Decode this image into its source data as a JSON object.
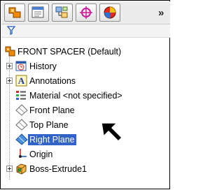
{
  "toolbar": {
    "tabs": [
      {
        "icon": "feature-manager-icon"
      },
      {
        "icon": "property-manager-icon"
      },
      {
        "icon": "configuration-manager-icon"
      },
      {
        "icon": "dimxpert-manager-icon"
      },
      {
        "icon": "display-manager-icon"
      }
    ],
    "overflow_label": "»"
  },
  "filter": {
    "icon": "filter-icon"
  },
  "tree": {
    "root": {
      "label": "FRONT SPACER  (Default)",
      "icon": "part-icon"
    },
    "items": [
      {
        "label": "History",
        "icon": "history-icon",
        "expandable": true
      },
      {
        "label": "Annotations",
        "icon": "annotations-icon",
        "expandable": true
      },
      {
        "label": "Material <not specified>",
        "icon": "material-icon",
        "expandable": false
      },
      {
        "label": "Front Plane",
        "icon": "plane-icon",
        "expandable": false
      },
      {
        "label": "Top Plane",
        "icon": "plane-icon",
        "expandable": false
      },
      {
        "label": "Right Plane",
        "icon": "plane-icon",
        "expandable": false,
        "selected": true
      },
      {
        "label": "Origin",
        "icon": "origin-icon",
        "expandable": false
      },
      {
        "label": "Boss-Extrude1",
        "icon": "boss-extrude-icon",
        "expandable": true
      }
    ]
  },
  "colors": {
    "selection": "#3163c9",
    "accent_orange": "#f08a00"
  }
}
